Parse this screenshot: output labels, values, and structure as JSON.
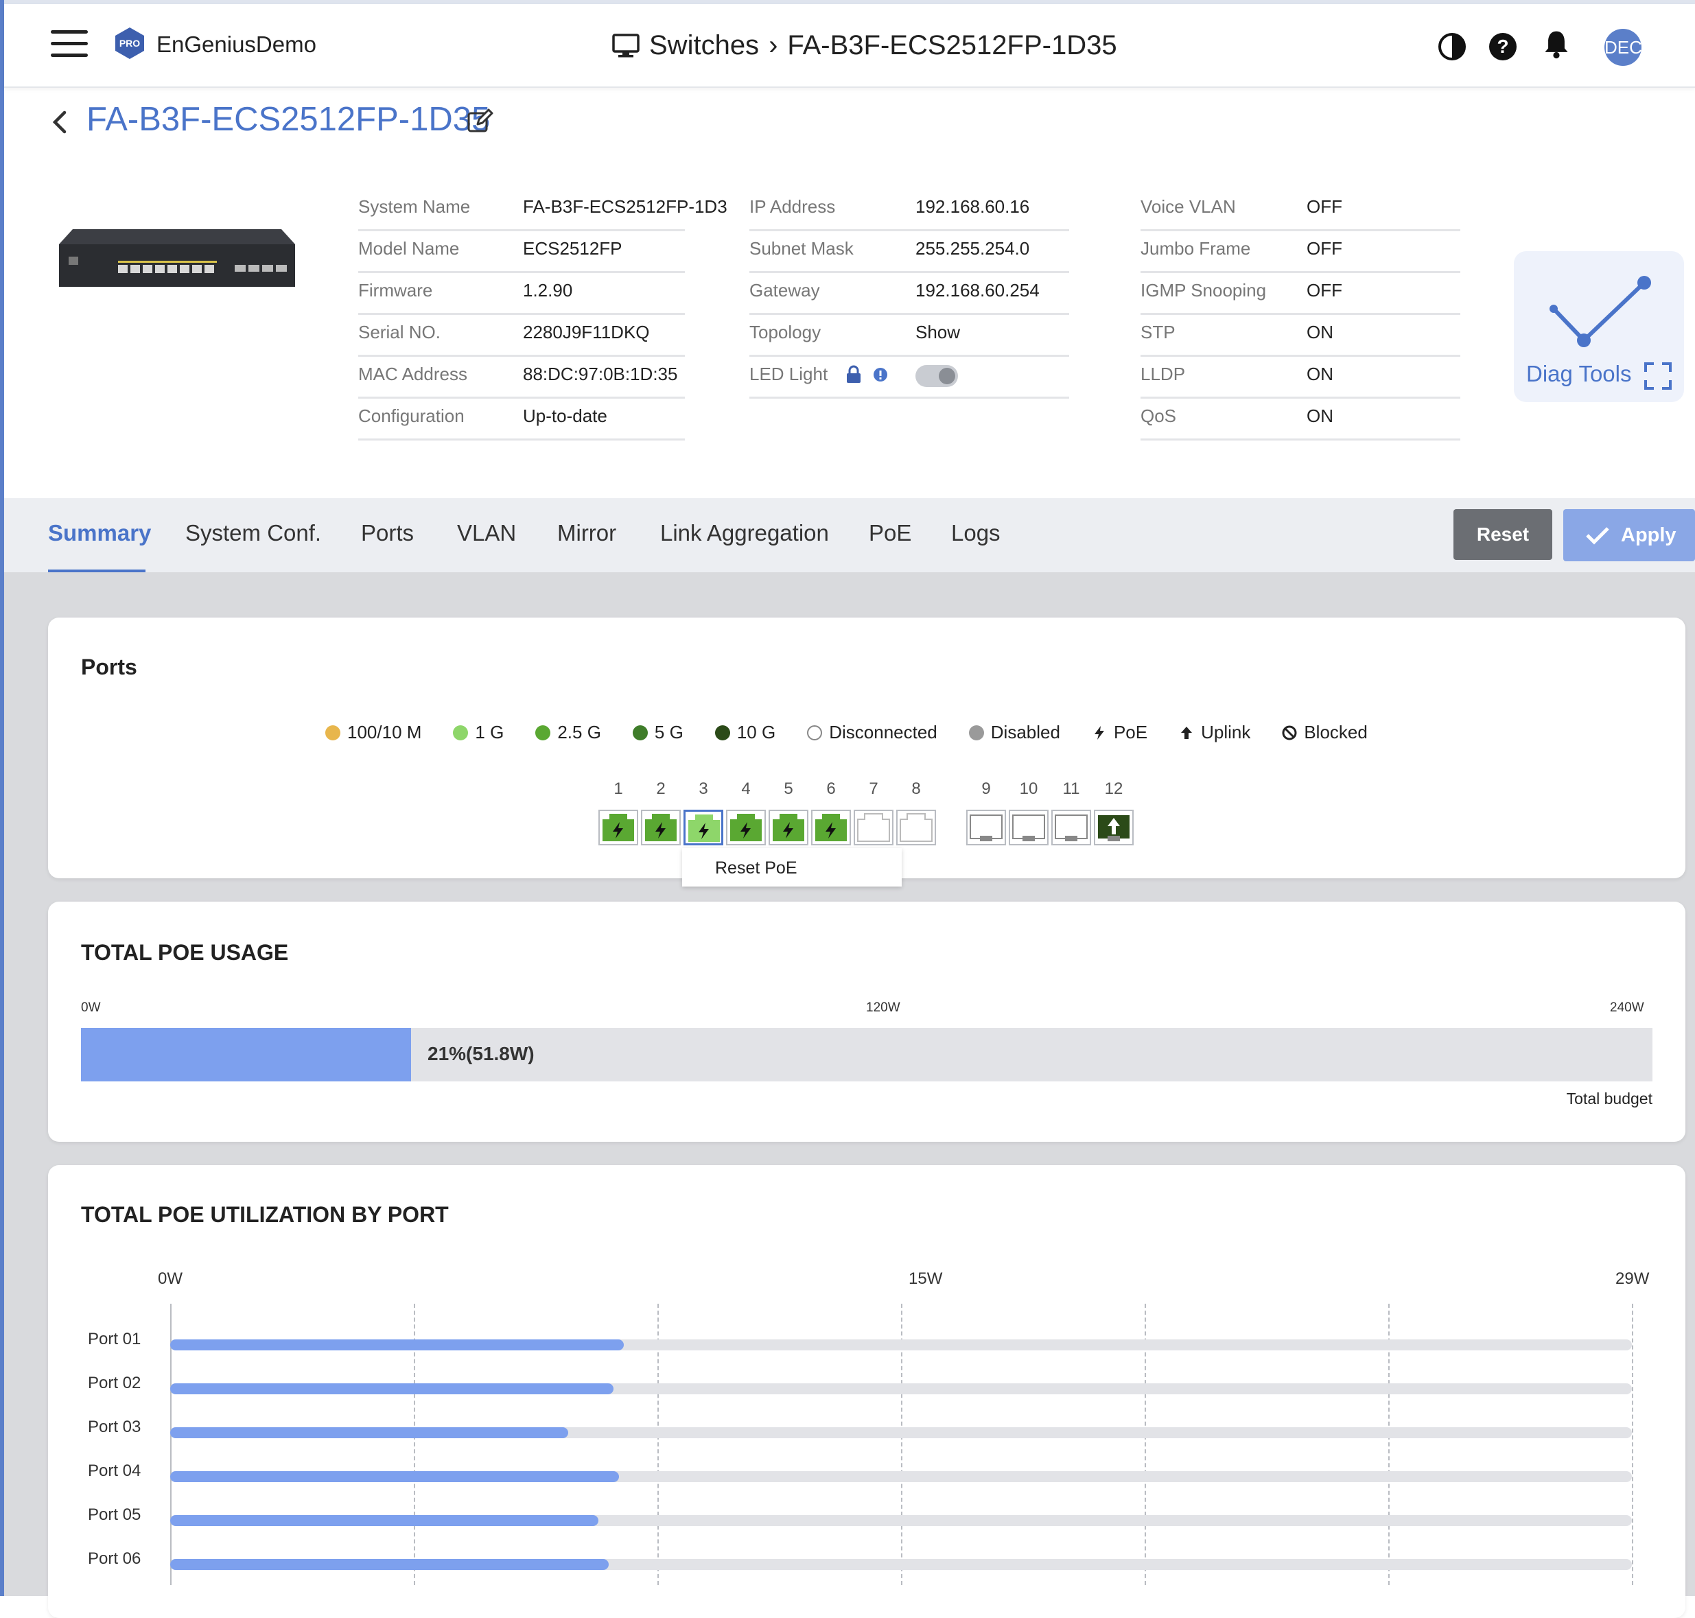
{
  "header": {
    "org_name": "EnGeniusDemo",
    "pro_badge": "PRO",
    "breadcrumb_section": "Switches",
    "breadcrumb_sep": "›",
    "breadcrumb_device": "FA-B3F-ECS2512FP-1D35",
    "avatar_text": "DEC"
  },
  "device": {
    "title": "FA-B3F-ECS2512FP-1D35",
    "info_col1": [
      {
        "key": "System Name",
        "value": "FA-B3F-ECS2512FP-1D3"
      },
      {
        "key": "Model Name",
        "value": "ECS2512FP"
      },
      {
        "key": "Firmware",
        "value": "1.2.90"
      },
      {
        "key": "Serial NO.",
        "value": "2280J9F11DKQ"
      },
      {
        "key": "MAC Address",
        "value": "88:DC:97:0B:1D:35"
      },
      {
        "key": "Configuration",
        "value": "Up-to-date"
      }
    ],
    "info_col2": [
      {
        "key": "IP Address",
        "value": "192.168.60.16"
      },
      {
        "key": "Subnet Mask",
        "value": "255.255.254.0"
      },
      {
        "key": "Gateway",
        "value": "192.168.60.254"
      },
      {
        "key": "Topology",
        "value": "Show"
      },
      {
        "key": "LED Light",
        "value": ""
      }
    ],
    "info_col3": [
      {
        "key": "Voice VLAN",
        "value": "OFF"
      },
      {
        "key": "Jumbo Frame",
        "value": "OFF"
      },
      {
        "key": "IGMP Snooping",
        "value": "OFF"
      },
      {
        "key": "STP",
        "value": "ON"
      },
      {
        "key": "LLDP",
        "value": "ON"
      },
      {
        "key": "QoS",
        "value": "ON"
      }
    ],
    "led_light_on": false,
    "diag_tools_label": "Diag Tools"
  },
  "tabs": [
    {
      "label": "Summary",
      "active": true
    },
    {
      "label": "System Conf.",
      "active": false
    },
    {
      "label": "Ports",
      "active": false
    },
    {
      "label": "VLAN",
      "active": false
    },
    {
      "label": "Mirror",
      "active": false
    },
    {
      "label": "Link Aggregation",
      "active": false
    },
    {
      "label": "PoE",
      "active": false
    },
    {
      "label": "Logs",
      "active": false
    }
  ],
  "actions": {
    "reset_label": "Reset",
    "apply_label": "Apply"
  },
  "ports_card": {
    "title": "Ports",
    "legend": [
      {
        "label": "100/10 M",
        "kind": "dot",
        "color": "#e8b64c"
      },
      {
        "label": "1 G",
        "kind": "dot",
        "color": "#8ed66a"
      },
      {
        "label": "2.5 G",
        "kind": "dot",
        "color": "#5aa832"
      },
      {
        "label": "5 G",
        "kind": "dot",
        "color": "#3f7d2a"
      },
      {
        "label": "10 G",
        "kind": "dot",
        "color": "#2b4a18"
      },
      {
        "label": "Disconnected",
        "kind": "ring",
        "color": "#ffffff"
      },
      {
        "label": "Disabled",
        "kind": "dot",
        "color": "#9a9a9a"
      },
      {
        "label": "PoE",
        "kind": "bolt-icon",
        "color": "#222222"
      },
      {
        "label": "Uplink",
        "kind": "up-arrow-icon",
        "color": "#222222"
      },
      {
        "label": "Blocked",
        "kind": "blocked-icon",
        "color": "#222222"
      }
    ],
    "ports": [
      {
        "num": "1",
        "state": "poe-1g",
        "color": "#5aa832"
      },
      {
        "num": "2",
        "state": "poe-1g",
        "color": "#5aa832"
      },
      {
        "num": "3",
        "state": "poe-1g-selected",
        "color": "#8ed66a"
      },
      {
        "num": "4",
        "state": "poe-1g",
        "color": "#5aa832"
      },
      {
        "num": "5",
        "state": "poe-1g",
        "color": "#5aa832"
      },
      {
        "num": "6",
        "state": "poe-1g",
        "color": "#5aa832"
      },
      {
        "num": "7",
        "state": "disconnected",
        "color": "#ffffff"
      },
      {
        "num": "8",
        "state": "disconnected",
        "color": "#ffffff"
      },
      {
        "num": "9",
        "state": "sfp-disconnected",
        "color": "#ffffff"
      },
      {
        "num": "10",
        "state": "sfp-disconnected",
        "color": "#ffffff"
      },
      {
        "num": "11",
        "state": "sfp-disconnected",
        "color": "#ffffff"
      },
      {
        "num": "12",
        "state": "uplink-10g",
        "color": "#2b4a18"
      }
    ],
    "tooltip": "Reset PoE"
  },
  "poe_usage": {
    "title": "TOTAL POE USAGE",
    "scale": [
      "0W",
      "120W",
      "240W"
    ],
    "percent": 21,
    "used_watts": 51.8,
    "label": "21%(51.8W)",
    "budget_label": "Total budget"
  },
  "chart_data": {
    "type": "bar",
    "title": "TOTAL POE UTILIZATION BY PORT",
    "orientation": "horizontal",
    "categories": [
      "Port 01",
      "Port 02",
      "Port 03",
      "Port 04",
      "Port 05",
      "Port 06"
    ],
    "values": [
      9.0,
      8.8,
      7.9,
      8.9,
      8.5,
      8.7
    ],
    "xlim": [
      0,
      29
    ],
    "tick_labels": [
      "0W",
      "15W",
      "29W"
    ],
    "grid": true
  }
}
